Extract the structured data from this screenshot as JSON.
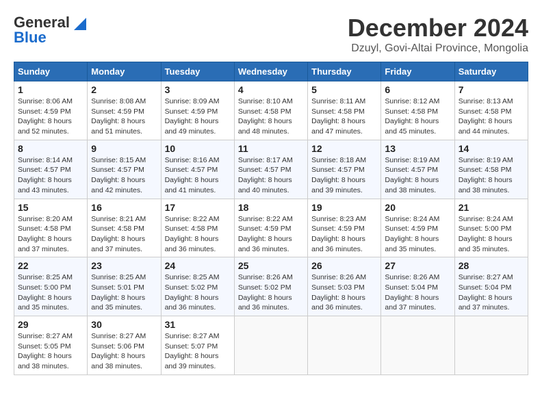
{
  "logo": {
    "line1": "General",
    "line2": "Blue"
  },
  "title": "December 2024",
  "location": "Dzuyl, Govi-Altai Province, Mongolia",
  "headers": [
    "Sunday",
    "Monday",
    "Tuesday",
    "Wednesday",
    "Thursday",
    "Friday",
    "Saturday"
  ],
  "weeks": [
    [
      {
        "day": "1",
        "sunrise": "8:06 AM",
        "sunset": "4:59 PM",
        "daylight": "8 hours and 52 minutes."
      },
      {
        "day": "2",
        "sunrise": "8:08 AM",
        "sunset": "4:59 PM",
        "daylight": "8 hours and 51 minutes."
      },
      {
        "day": "3",
        "sunrise": "8:09 AM",
        "sunset": "4:59 PM",
        "daylight": "8 hours and 49 minutes."
      },
      {
        "day": "4",
        "sunrise": "8:10 AM",
        "sunset": "4:58 PM",
        "daylight": "8 hours and 48 minutes."
      },
      {
        "day": "5",
        "sunrise": "8:11 AM",
        "sunset": "4:58 PM",
        "daylight": "8 hours and 47 minutes."
      },
      {
        "day": "6",
        "sunrise": "8:12 AM",
        "sunset": "4:58 PM",
        "daylight": "8 hours and 45 minutes."
      },
      {
        "day": "7",
        "sunrise": "8:13 AM",
        "sunset": "4:58 PM",
        "daylight": "8 hours and 44 minutes."
      }
    ],
    [
      {
        "day": "8",
        "sunrise": "8:14 AM",
        "sunset": "4:57 PM",
        "daylight": "8 hours and 43 minutes."
      },
      {
        "day": "9",
        "sunrise": "8:15 AM",
        "sunset": "4:57 PM",
        "daylight": "8 hours and 42 minutes."
      },
      {
        "day": "10",
        "sunrise": "8:16 AM",
        "sunset": "4:57 PM",
        "daylight": "8 hours and 41 minutes."
      },
      {
        "day": "11",
        "sunrise": "8:17 AM",
        "sunset": "4:57 PM",
        "daylight": "8 hours and 40 minutes."
      },
      {
        "day": "12",
        "sunrise": "8:18 AM",
        "sunset": "4:57 PM",
        "daylight": "8 hours and 39 minutes."
      },
      {
        "day": "13",
        "sunrise": "8:19 AM",
        "sunset": "4:57 PM",
        "daylight": "8 hours and 38 minutes."
      },
      {
        "day": "14",
        "sunrise": "8:19 AM",
        "sunset": "4:58 PM",
        "daylight": "8 hours and 38 minutes."
      }
    ],
    [
      {
        "day": "15",
        "sunrise": "8:20 AM",
        "sunset": "4:58 PM",
        "daylight": "8 hours and 37 minutes."
      },
      {
        "day": "16",
        "sunrise": "8:21 AM",
        "sunset": "4:58 PM",
        "daylight": "8 hours and 37 minutes."
      },
      {
        "day": "17",
        "sunrise": "8:22 AM",
        "sunset": "4:58 PM",
        "daylight": "8 hours and 36 minutes."
      },
      {
        "day": "18",
        "sunrise": "8:22 AM",
        "sunset": "4:59 PM",
        "daylight": "8 hours and 36 minutes."
      },
      {
        "day": "19",
        "sunrise": "8:23 AM",
        "sunset": "4:59 PM",
        "daylight": "8 hours and 36 minutes."
      },
      {
        "day": "20",
        "sunrise": "8:24 AM",
        "sunset": "4:59 PM",
        "daylight": "8 hours and 35 minutes."
      },
      {
        "day": "21",
        "sunrise": "8:24 AM",
        "sunset": "5:00 PM",
        "daylight": "8 hours and 35 minutes."
      }
    ],
    [
      {
        "day": "22",
        "sunrise": "8:25 AM",
        "sunset": "5:00 PM",
        "daylight": "8 hours and 35 minutes."
      },
      {
        "day": "23",
        "sunrise": "8:25 AM",
        "sunset": "5:01 PM",
        "daylight": "8 hours and 35 minutes."
      },
      {
        "day": "24",
        "sunrise": "8:25 AM",
        "sunset": "5:02 PM",
        "daylight": "8 hours and 36 minutes."
      },
      {
        "day": "25",
        "sunrise": "8:26 AM",
        "sunset": "5:02 PM",
        "daylight": "8 hours and 36 minutes."
      },
      {
        "day": "26",
        "sunrise": "8:26 AM",
        "sunset": "5:03 PM",
        "daylight": "8 hours and 36 minutes."
      },
      {
        "day": "27",
        "sunrise": "8:26 AM",
        "sunset": "5:04 PM",
        "daylight": "8 hours and 37 minutes."
      },
      {
        "day": "28",
        "sunrise": "8:27 AM",
        "sunset": "5:04 PM",
        "daylight": "8 hours and 37 minutes."
      }
    ],
    [
      {
        "day": "29",
        "sunrise": "8:27 AM",
        "sunset": "5:05 PM",
        "daylight": "8 hours and 38 minutes."
      },
      {
        "day": "30",
        "sunrise": "8:27 AM",
        "sunset": "5:06 PM",
        "daylight": "8 hours and 38 minutes."
      },
      {
        "day": "31",
        "sunrise": "8:27 AM",
        "sunset": "5:07 PM",
        "daylight": "8 hours and 39 minutes."
      },
      null,
      null,
      null,
      null
    ]
  ]
}
